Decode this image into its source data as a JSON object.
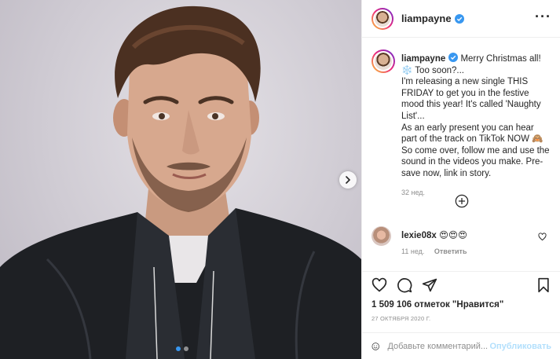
{
  "post": {
    "username": "liampayne",
    "more_icon": "more-horizontal-icon",
    "verified_icon": "verified-badge-icon",
    "carousel": {
      "slide_count": 2,
      "active_slide": 1,
      "next_icon": "chevron-right-icon"
    }
  },
  "caption": {
    "username": "liampayne",
    "text": "Merry Christmas all! ❄️ Too soon?...\nI'm releasing a new single THIS FRIDAY to get you in the festive mood this year! It's called 'Naughty List'...\nAs an early present you can hear part of the track on TikTok NOW 🙈 So come over, follow me and use the sound in the videos you make. Pre-save now, link in story.",
    "time": "32 нед."
  },
  "load_more_icon": "plus-circle-icon",
  "comments": [
    {
      "username": "lexie08x",
      "text": "😍😍😍",
      "time": "11 нед.",
      "reply_label": "Ответить",
      "like_icon": "heart-outline-icon"
    }
  ],
  "actions": {
    "icons": [
      "heart-outline-icon",
      "comment-icon",
      "share-icon",
      "bookmark-icon"
    ],
    "likes": "1 509 106 отметок \"Нравится\"",
    "date": "27 октября 2020 г."
  },
  "add_comment": {
    "emoji_icon": "emoji-icon",
    "placeholder": "Добавьте комментарий...",
    "publish_label": "Опубликовать"
  },
  "colors": {
    "accent": "#3897f0",
    "publish_disabled": "#b2dffc",
    "muted": "#8e8e8e"
  }
}
